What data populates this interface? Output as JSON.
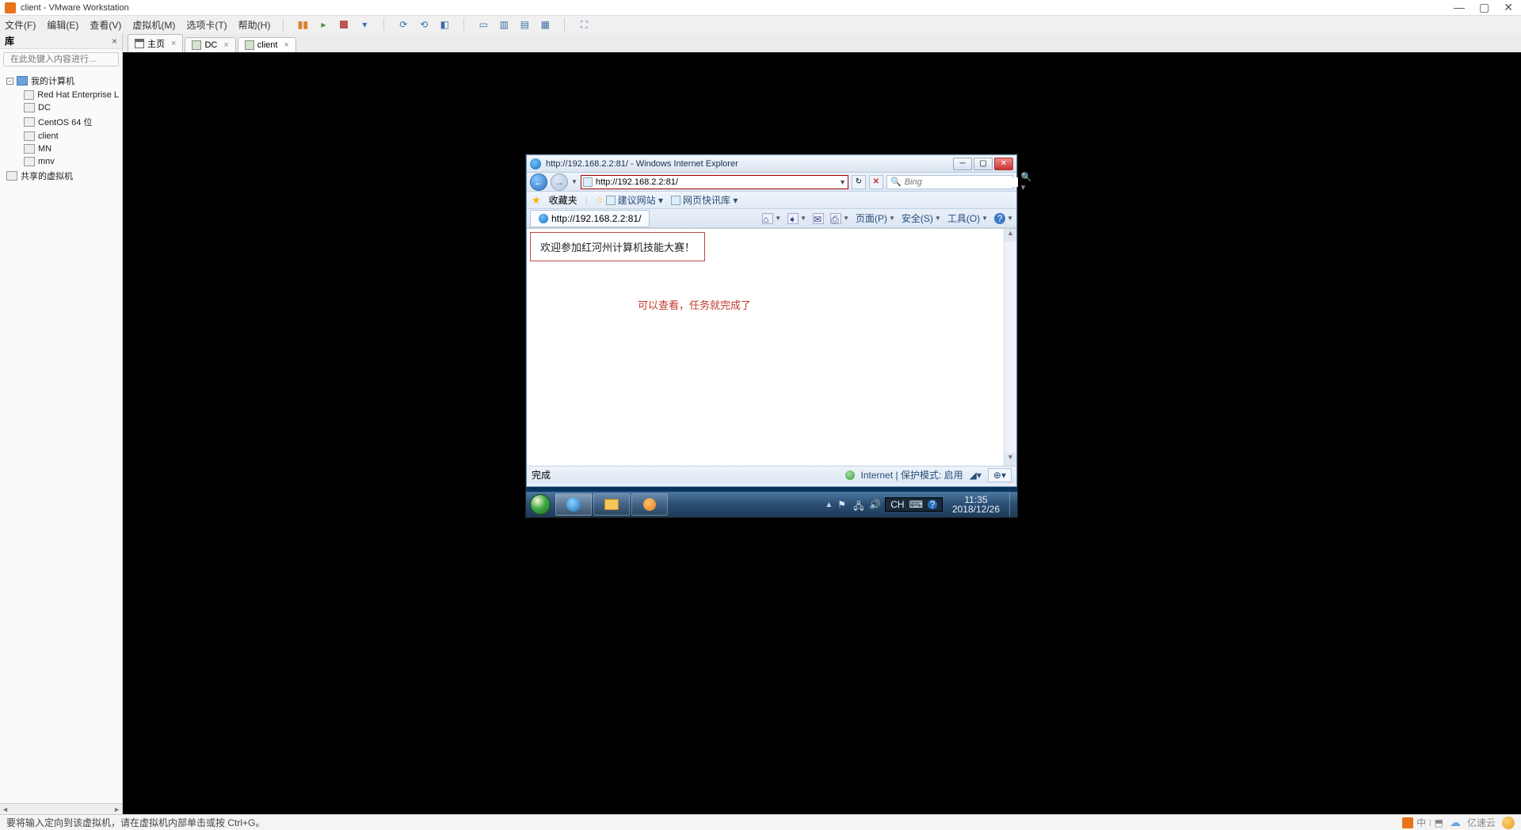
{
  "vmware": {
    "title": "client - VMware Workstation",
    "menu": {
      "file": "文件(F)",
      "edit": "编辑(E)",
      "view": "查看(V)",
      "vm": "虚拟机(M)",
      "tabs": "选项卡(T)",
      "help": "帮助(H)"
    },
    "sidebar": {
      "header": "库",
      "search_placeholder": "在此处键入内容进行...",
      "root": "我的计算机",
      "items": [
        "Red Hat Enterprise L",
        "DC",
        "CentOS 64 位",
        "client",
        "MN",
        "mnv"
      ],
      "shared": "共享的虚拟机"
    },
    "tabs": [
      {
        "label": "主页"
      },
      {
        "label": "DC"
      },
      {
        "label": "client"
      }
    ],
    "status": "要将输入定向到该虚拟机，请在虚拟机内部单击或按 Ctrl+G。",
    "watermark": "亿速云"
  },
  "ie": {
    "title": "http://192.168.2.2:81/ - Windows Internet Explorer",
    "url": "http://192.168.2.2:81/",
    "search_placeholder": "Bing",
    "fav_label": "收藏夹",
    "fav_items": [
      "建议网站 ▾",
      "网页快讯库 ▾"
    ],
    "tab_label": "http://192.168.2.2:81/",
    "toolbar": {
      "page": "页面(P)",
      "safety": "安全(S)",
      "tools": "工具(O)"
    },
    "page_text": "欢迎参加红河州计算机技能大赛！",
    "page_note": "可以查看，任务就完成了",
    "status_done": "完成",
    "status_zone": "Internet | 保护模式: 启用"
  },
  "taskbar": {
    "lang": "CH",
    "time": "11:35",
    "date": "2018/12/26"
  }
}
